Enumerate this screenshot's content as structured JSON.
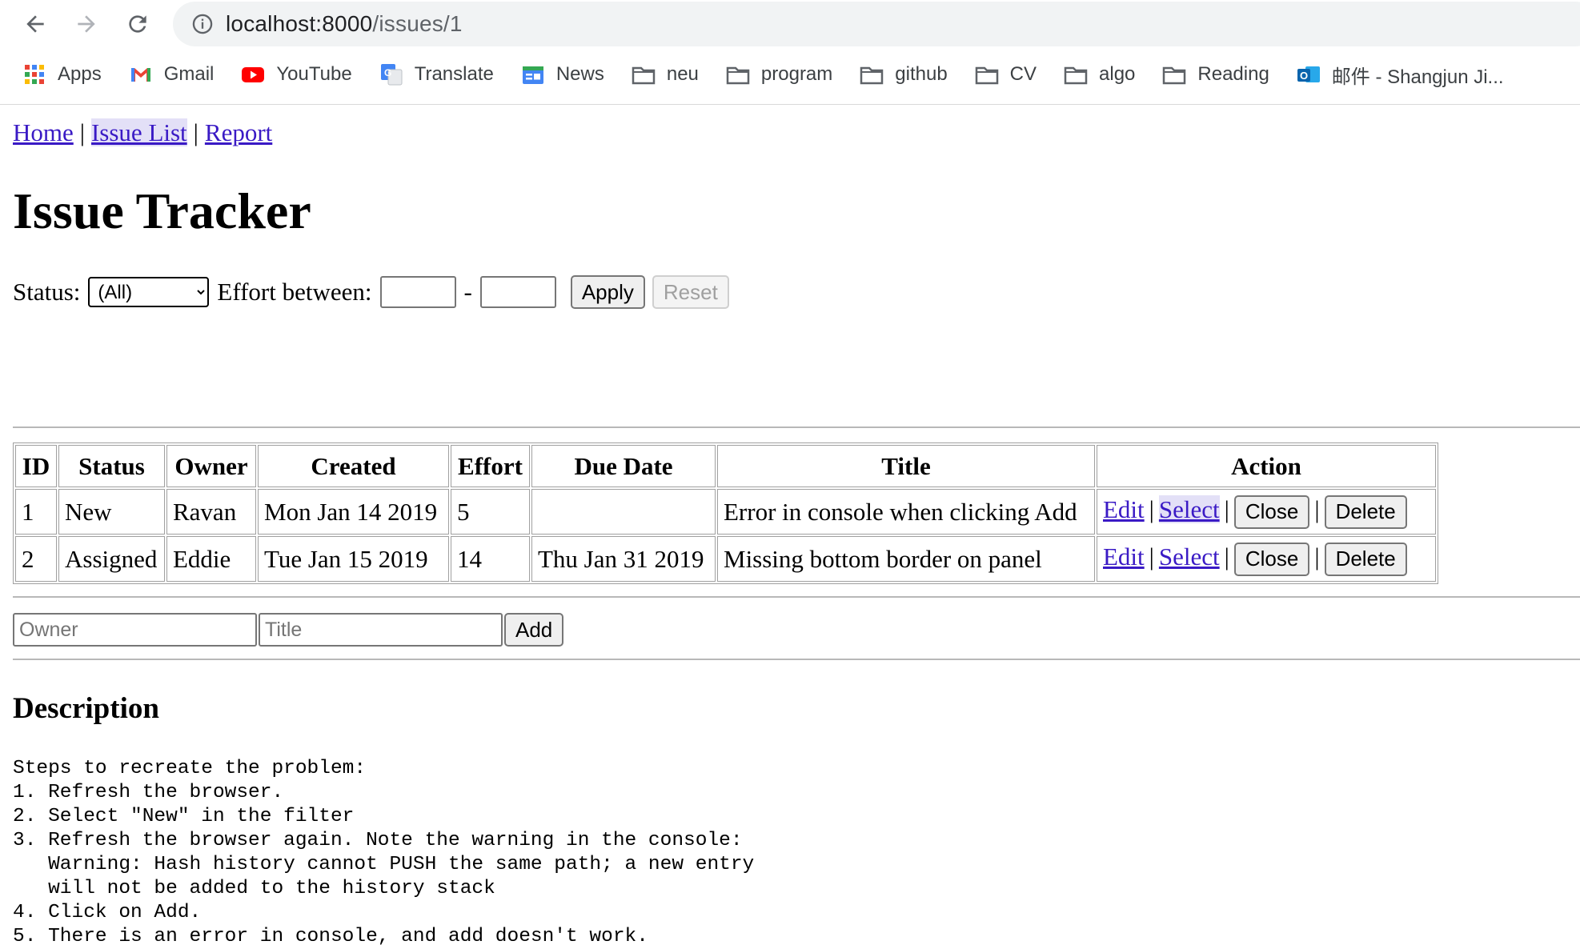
{
  "browser": {
    "url_host": "localhost:8000",
    "url_path": "/issues/1",
    "bookmarks": [
      {
        "label": "Apps",
        "icon": "apps-grid-icon"
      },
      {
        "label": "Gmail",
        "icon": "gmail-icon"
      },
      {
        "label": "YouTube",
        "icon": "youtube-icon"
      },
      {
        "label": "Translate",
        "icon": "translate-icon"
      },
      {
        "label": "News",
        "icon": "news-icon"
      },
      {
        "label": "neu",
        "icon": "folder-icon"
      },
      {
        "label": "program",
        "icon": "folder-icon"
      },
      {
        "label": "github",
        "icon": "folder-icon"
      },
      {
        "label": "CV",
        "icon": "folder-icon"
      },
      {
        "label": "algo",
        "icon": "folder-icon"
      },
      {
        "label": "Reading",
        "icon": "folder-icon"
      },
      {
        "label": "邮件 - Shangjun Ji...",
        "icon": "outlook-icon"
      }
    ]
  },
  "nav": {
    "home": "Home",
    "sep1": "|",
    "issue_list": "Issue List",
    "sep2": "|",
    "report": "Report"
  },
  "page": {
    "title": "Issue Tracker"
  },
  "filter": {
    "status_label": "Status:",
    "status_value": "(All)",
    "effort_label": "Effort between:",
    "dash": "-",
    "apply": "Apply",
    "reset": "Reset"
  },
  "table": {
    "headers": [
      "ID",
      "Status",
      "Owner",
      "Created",
      "Effort",
      "Due Date",
      "Title",
      "Action"
    ],
    "rows": [
      {
        "id": "1",
        "status": "New",
        "owner": "Ravan",
        "created": "Mon Jan 14 2019",
        "effort": "5",
        "due": "",
        "title": "Error in console when clicking Add"
      },
      {
        "id": "2",
        "status": "Assigned",
        "owner": "Eddie",
        "created": "Tue Jan 15 2019",
        "effort": "14",
        "due": "Thu Jan 31 2019",
        "title": "Missing bottom border on panel"
      }
    ],
    "actions": {
      "edit": "Edit",
      "select": "Select",
      "close": "Close",
      "delete": "Delete",
      "sep": "|"
    }
  },
  "add_form": {
    "owner_placeholder": "Owner",
    "title_placeholder": "Title",
    "add": "Add"
  },
  "description": {
    "heading": "Description",
    "text": "Steps to recreate the problem:\n1. Refresh the browser.\n2. Select \"New\" in the filter\n3. Refresh the browser again. Note the warning in the console:\n   Warning: Hash history cannot PUSH the same path; a new entry\n   will not be added to the history stack\n4. Click on Add.\n5. There is an error in console, and add doesn't work."
  },
  "colors": {
    "link": "#3a1ac5",
    "omnibox_bg": "#f1f3f4"
  }
}
